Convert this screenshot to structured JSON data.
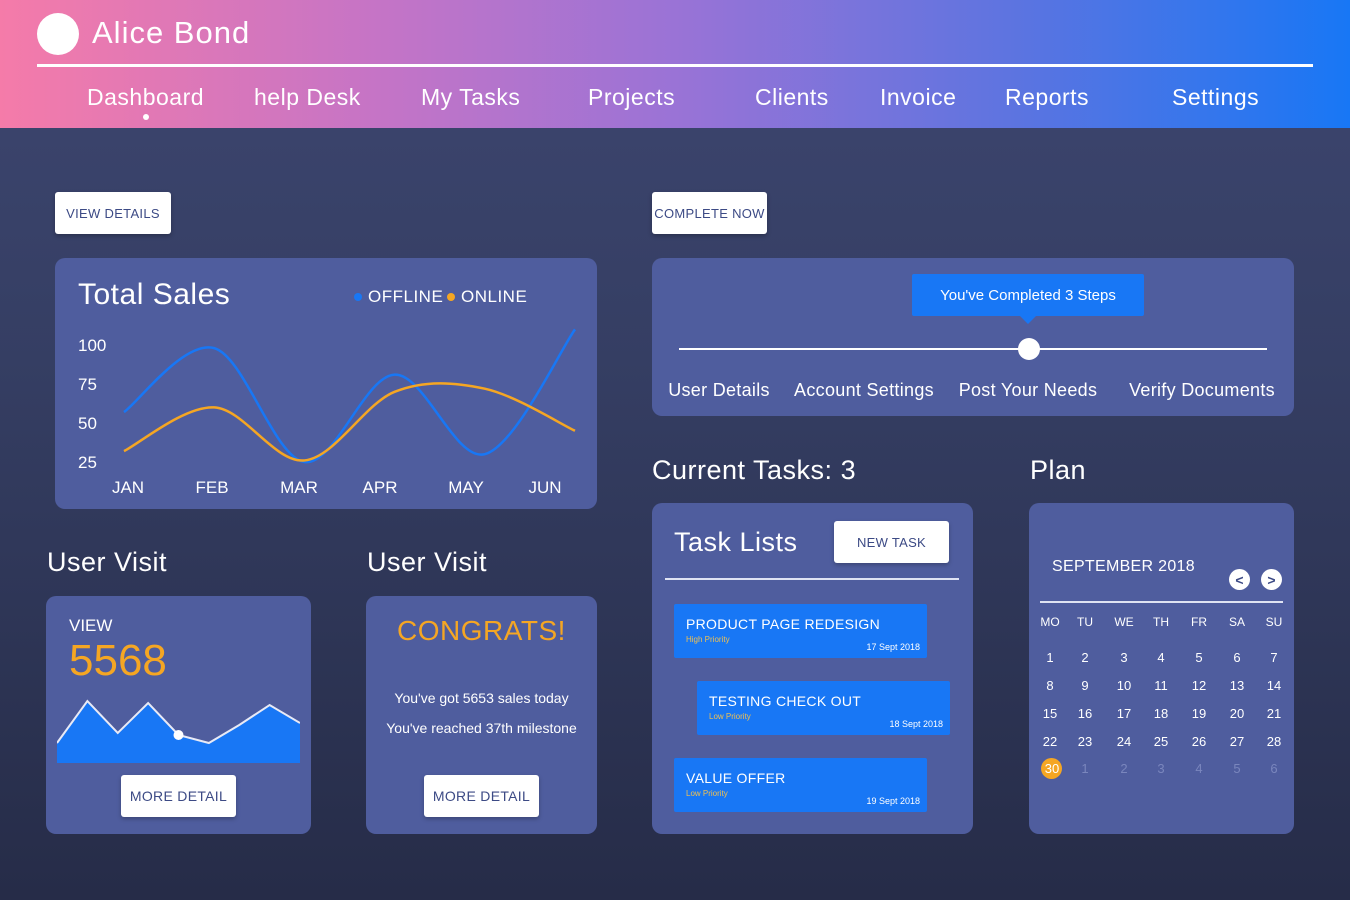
{
  "header": {
    "user_name": "Alice Bond",
    "nav": [
      "Dashboard",
      "help Desk",
      "My Tasks",
      "Projects",
      "Clients",
      "Invoice",
      "Reports",
      "Settings"
    ],
    "active": "Dashboard"
  },
  "buttons": {
    "view_details": "VIEW DETAILS",
    "complete_now": "COMPLETE NOW",
    "more_detail": "MORE DETAIL",
    "new_task": "NEW TASK"
  },
  "sales": {
    "title": "Total Sales",
    "legend": [
      {
        "name": "OFFLINE",
        "color": "#1877f5"
      },
      {
        "name": "ONLINE",
        "color": "#f5a623"
      }
    ]
  },
  "chart_data": {
    "type": "line",
    "title": "Total Sales",
    "categories": [
      "JAN",
      "FEB",
      "MAR",
      "APR",
      "MAY",
      "JUN"
    ],
    "yticks": [
      100,
      75,
      50,
      25
    ],
    "ylim": [
      25,
      100
    ],
    "grid": false,
    "legend_position": "top-right",
    "series": [
      {
        "name": "OFFLINE",
        "color": "#1877f5",
        "values": [
          57,
          98,
          25,
          81,
          30,
          110
        ]
      },
      {
        "name": "ONLINE",
        "color": "#f5a623",
        "values": [
          32,
          60,
          26,
          70,
          72,
          45
        ]
      }
    ]
  },
  "steps": {
    "tooltip": "You've Completed 3 Steps",
    "labels": [
      "User Details",
      "Account Settings",
      "Post Your Needs",
      "Verify Documents"
    ],
    "completed": 3
  },
  "visit1": {
    "title": "User Visit",
    "label": "VIEW",
    "value": "5568",
    "sparkline": [
      20,
      62,
      30,
      60,
      28,
      20,
      38,
      58,
      40
    ]
  },
  "visit2": {
    "title": "User Visit",
    "headline": "CONGRATS!",
    "line1": "You've got 5653 sales today",
    "line2": "You've reached 37th milestone"
  },
  "tasks": {
    "section_title": "Current Tasks: 3",
    "card_title": "Task Lists",
    "items": [
      {
        "title": "PRODUCT PAGE REDESIGN",
        "priority": "High Priority",
        "date": "17 Sept 2018"
      },
      {
        "title": "TESTING CHECK OUT",
        "priority": "Low Priority",
        "date": "18 Sept 2018"
      },
      {
        "title": "VALUE OFFER",
        "priority": "Low Priority",
        "date": "19 Sept 2018"
      }
    ]
  },
  "plan": {
    "section_title": "Plan",
    "month": "SEPTEMBER 2018",
    "prev": "<",
    "next": ">",
    "weekdays": [
      "MO",
      "TU",
      "WE",
      "TH",
      "FR",
      "SA",
      "SU"
    ],
    "days": [
      [
        "1",
        "2",
        "3",
        "4",
        "5",
        "6",
        "7"
      ],
      [
        "8",
        "9",
        "10",
        "11",
        "12",
        "13",
        "14"
      ],
      [
        "15",
        "16",
        "17",
        "18",
        "19",
        "20",
        "21"
      ],
      [
        "22",
        "23",
        "24",
        "25",
        "26",
        "27",
        "28"
      ],
      [
        "30",
        "1",
        "2",
        "3",
        "4",
        "5",
        "6"
      ]
    ],
    "today": "30"
  }
}
